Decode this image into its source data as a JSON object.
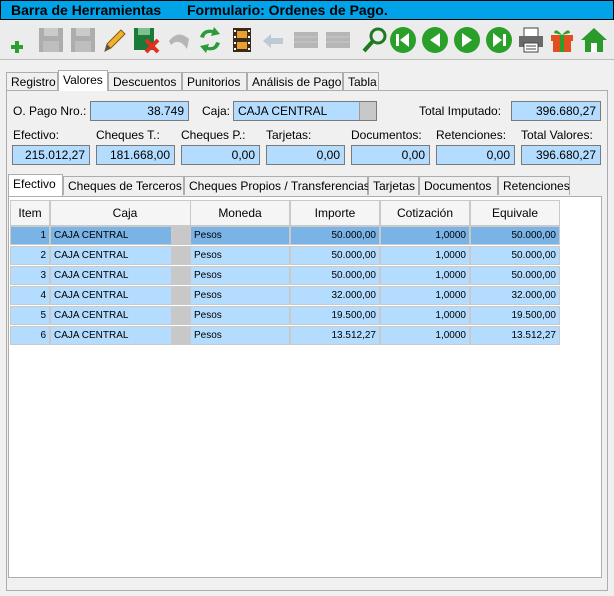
{
  "window": {
    "title": "Barra de Herramientas",
    "form_title": "Formulario: Ordenes de Pago."
  },
  "toolbar": {
    "buttons": [
      {
        "name": "add-icon",
        "enabled": true
      },
      {
        "name": "save-icon",
        "enabled": false
      },
      {
        "name": "save-as-icon",
        "enabled": false
      },
      {
        "name": "edit-pencil-icon",
        "enabled": true
      },
      {
        "name": "delete-icon",
        "enabled": true
      },
      {
        "name": "undo-icon",
        "enabled": false
      },
      {
        "name": "refresh-icon",
        "enabled": true
      },
      {
        "name": "film-icon",
        "enabled": true
      },
      {
        "name": "back-arrow-icon",
        "enabled": false
      },
      {
        "name": "grid-icon",
        "enabled": false
      },
      {
        "name": "grid2-icon",
        "enabled": false
      },
      {
        "name": "search-icon",
        "enabled": true
      },
      {
        "name": "first-record-icon",
        "enabled": true
      },
      {
        "name": "prev-record-icon",
        "enabled": true
      },
      {
        "name": "next-record-icon",
        "enabled": true
      },
      {
        "name": "last-record-icon",
        "enabled": true
      },
      {
        "name": "printer-icon",
        "enabled": true
      },
      {
        "name": "gift-icon",
        "enabled": true
      },
      {
        "name": "home-icon",
        "enabled": true
      }
    ]
  },
  "tabs": [
    "Registro",
    "Valores",
    "Descuentos",
    "Punitorios",
    "Análisis de Pago",
    "Tabla"
  ],
  "active_tab": "Valores",
  "header": {
    "opago_label": "O. Pago Nro.:",
    "opago_value": "38.749",
    "caja_label": "Caja:",
    "caja_value": "CAJA CENTRAL",
    "total_imputado_label": "Total Imputado:",
    "total_imputado_value": "396.680,27"
  },
  "totals": [
    {
      "label": "Efectivo:",
      "value": "215.012,27"
    },
    {
      "label": "Cheques T.:",
      "value": "181.668,00"
    },
    {
      "label": "Cheques P.:",
      "value": "0,00"
    },
    {
      "label": "Tarjetas:",
      "value": "0,00"
    },
    {
      "label": "Documentos:",
      "value": "0,00"
    },
    {
      "label": "Retenciones:",
      "value": "0,00"
    },
    {
      "label": "Total Valores:",
      "value": "396.680,27"
    }
  ],
  "subtabs": [
    "Efectivo",
    "Cheques de Terceros",
    "Cheques Propios / Transferencias",
    "Tarjetas",
    "Documentos",
    "Retenciones"
  ],
  "active_subtab": "Efectivo",
  "grid": {
    "columns": [
      "Item",
      "Caja",
      "Moneda",
      "Importe",
      "Cotización",
      "Equivale"
    ],
    "rows": [
      {
        "item": "1",
        "caja": "CAJA CENTRAL",
        "moneda": "Pesos",
        "importe": "50.000,00",
        "cotizacion": "1,0000",
        "equivale": "50.000,00"
      },
      {
        "item": "2",
        "caja": "CAJA CENTRAL",
        "moneda": "Pesos",
        "importe": "50.000,00",
        "cotizacion": "1,0000",
        "equivale": "50.000,00"
      },
      {
        "item": "3",
        "caja": "CAJA CENTRAL",
        "moneda": "Pesos",
        "importe": "50.000,00",
        "cotizacion": "1,0000",
        "equivale": "50.000,00"
      },
      {
        "item": "4",
        "caja": "CAJA CENTRAL",
        "moneda": "Pesos",
        "importe": "32.000,00",
        "cotizacion": "1,0000",
        "equivale": "32.000,00"
      },
      {
        "item": "5",
        "caja": "CAJA CENTRAL",
        "moneda": "Pesos",
        "importe": "19.500,00",
        "cotizacion": "1,0000",
        "equivale": "19.500,00"
      },
      {
        "item": "6",
        "caja": "CAJA CENTRAL",
        "moneda": "Pesos",
        "importe": "13.512,27",
        "cotizacion": "1,0000",
        "equivale": "13.512,27"
      }
    ]
  },
  "colors": {
    "title_bar": "#00a2e8",
    "field_bg": "#b4dcff",
    "selected_row": "#7ab3e6"
  }
}
